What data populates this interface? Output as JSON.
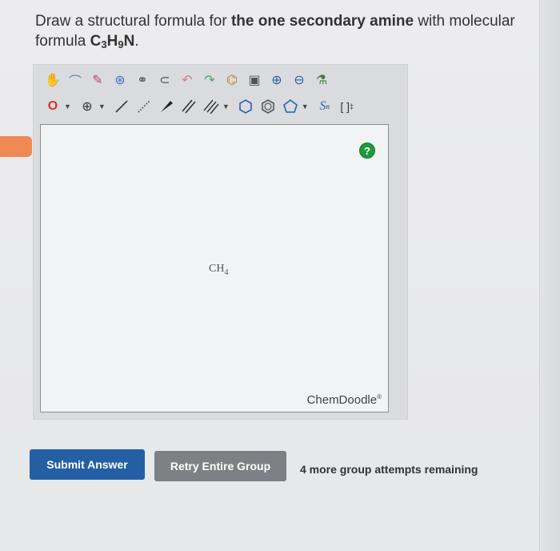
{
  "question": {
    "prefix": "Draw a structural formula for ",
    "bold": "the one secondary amine",
    "suffix": " with molecular formula ",
    "formula": {
      "c": "C",
      "c_n": "3",
      "h": "H",
      "h_n": "9",
      "n": "N"
    },
    "period": "."
  },
  "toolbar": {
    "row1": [
      {
        "name": "hand-icon",
        "glyph": "✋",
        "color": "#8a5a2b"
      },
      {
        "name": "lasso-icon",
        "glyph": "⌒",
        "color": "#6a7fa8"
      },
      {
        "name": "eraser-icon",
        "glyph": "✎",
        "color": "#c0436b"
      },
      {
        "name": "center-icon",
        "glyph": "⊛",
        "color": "#3a6ec7"
      },
      {
        "name": "copy-icon",
        "glyph": "⚭",
        "color": "#555"
      },
      {
        "name": "paste-icon",
        "glyph": "⊂",
        "color": "#555"
      },
      {
        "name": "undo-icon",
        "glyph": "↶",
        "color": "#d97a8c"
      },
      {
        "name": "redo-icon",
        "glyph": "↷",
        "color": "#4aa66a"
      },
      {
        "name": "template-icon",
        "glyph": "⌬",
        "color": "#b08a1e"
      },
      {
        "name": "clear-icon",
        "glyph": "▣",
        "color": "#555"
      },
      {
        "name": "zoom-in-icon",
        "glyph": "⊕",
        "color": "#2d5fa8"
      },
      {
        "name": "zoom-out-icon",
        "glyph": "⊖",
        "color": "#2d5fa8"
      },
      {
        "name": "clean-icon",
        "glyph": "⚗",
        "color": "#3f7a3f"
      }
    ],
    "row2": {
      "atom_label": "O",
      "charge_label": "⊕",
      "bracket_label": "[ ]",
      "bracket_sup": "‡",
      "sn_label": "S",
      "sn_sub": "n"
    }
  },
  "canvas": {
    "help": "?",
    "molecule": {
      "main": "CH",
      "sub": "4"
    },
    "brand": "ChemDoodle",
    "brand_mark": "®"
  },
  "buttons": {
    "submit": "Submit Answer",
    "retry": "Retry Entire Group"
  },
  "status": {
    "remaining": "4 more group attempts remaining"
  },
  "colors": {
    "submit": "#245fa3",
    "retry": "#7d8084",
    "help": "#1f9a3b",
    "tab": "#ef8a52"
  }
}
